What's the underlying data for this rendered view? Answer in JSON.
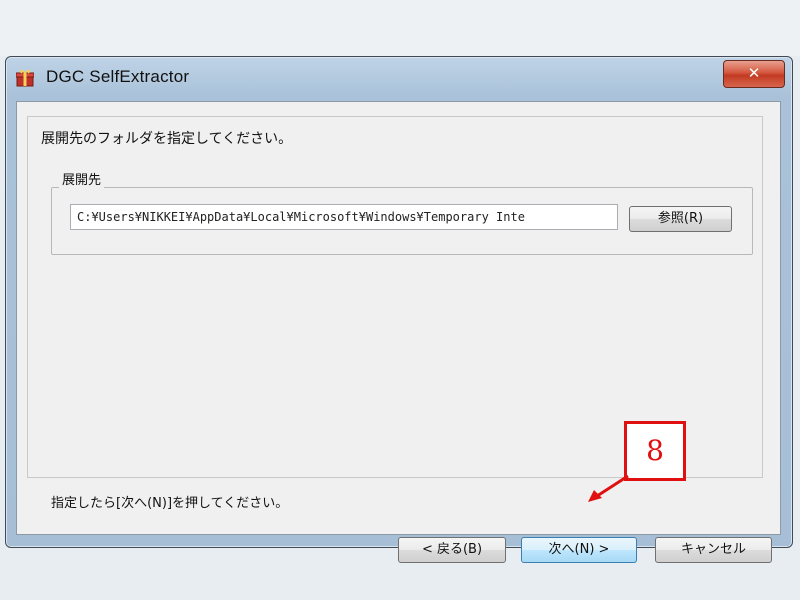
{
  "window": {
    "title": "DGC SelfExtractor",
    "close_glyph": "✕"
  },
  "content": {
    "instruction": "展開先のフォルダを指定してください。",
    "group_label": "展開先",
    "path_value": "C:¥Users¥NIKKEI¥AppData¥Local¥Microsoft¥Windows¥Temporary Inte",
    "browse_label": "参照(R)",
    "footer_note": "指定したら[次へ(N)]を押してください。"
  },
  "buttons": {
    "back_label": "< 戻る(B)",
    "next_label": "次へ(N) >",
    "cancel_label": "キャンセル"
  },
  "annotation": {
    "callout_number": "8",
    "color": "#e01010"
  },
  "icons": {
    "app": "gift-box-icon",
    "close": "close-icon"
  }
}
